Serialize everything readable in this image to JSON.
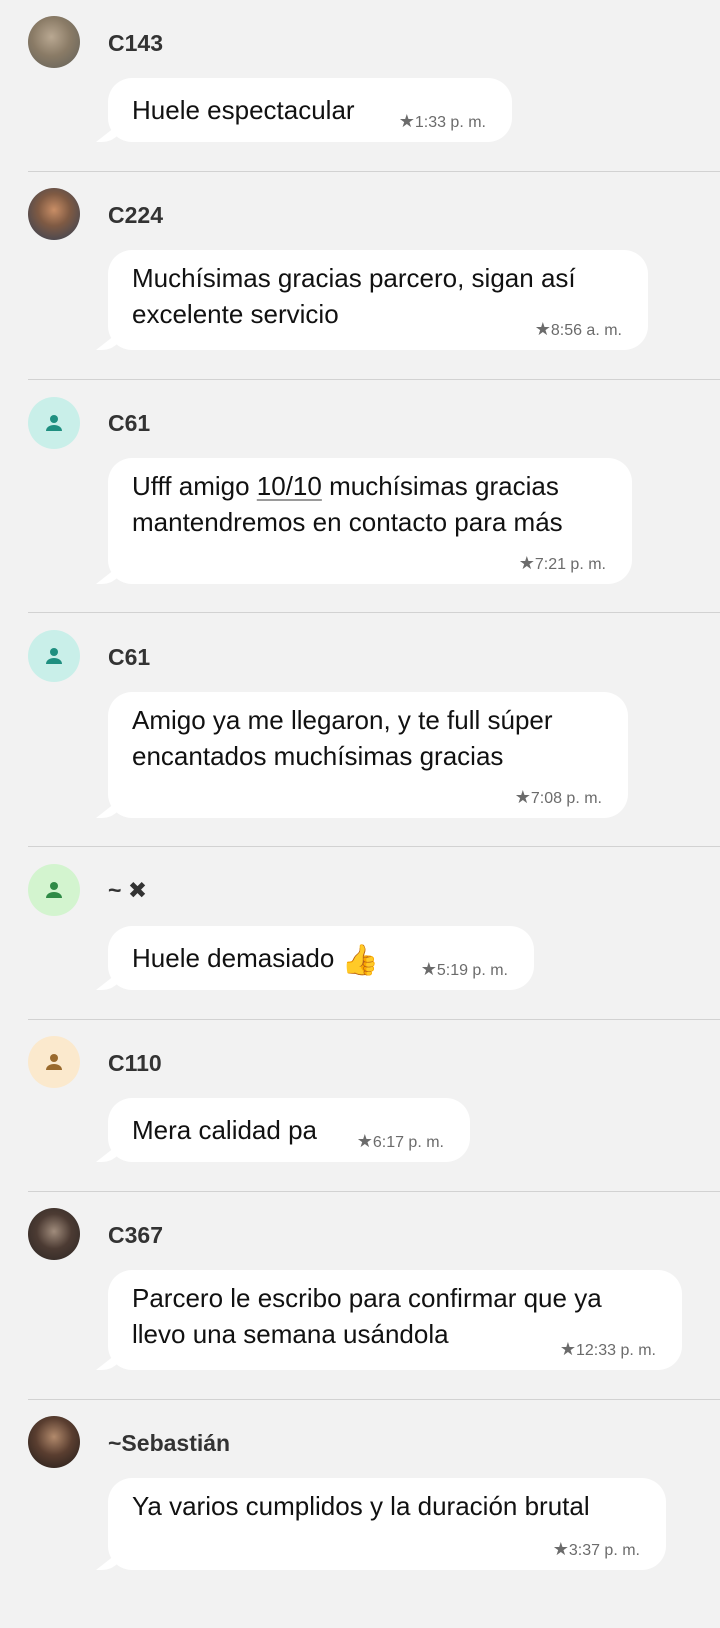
{
  "messages": [
    {
      "name": "C143",
      "text": "Huele espectacular",
      "time": "1:33 p. m.",
      "avatar": "photo"
    },
    {
      "name": "C224",
      "text": "Muchísimas gracias parcero, sigan así excelente servicio",
      "time": "8:56 a. m.",
      "avatar": "photo"
    },
    {
      "name": "C61",
      "text_before": "Ufff amigo ",
      "text_link": "10/10",
      "text_after": " muchísimas gracias mantendremos en contacto para más",
      "time": "7:21 p. m.",
      "avatar": "person-icon",
      "avatar_color": "#c9efe9"
    },
    {
      "name": "C61",
      "text": "Amigo ya me llegaron, y te full súper encantados muchísimas gracias",
      "time": "7:08 p. m.",
      "avatar": "person-icon",
      "avatar_color": "#c9efe9"
    },
    {
      "name": "~ ✖",
      "text": "Huele demasiado",
      "emoji": "👍",
      "time": "5:19 p. m.",
      "avatar": "person-icon",
      "avatar_color": "#d3f4cf"
    },
    {
      "name": "C110",
      "text": "Mera calidad pa",
      "time": "6:17 p. m.",
      "avatar": "person-icon",
      "avatar_color": "#fbe9cd"
    },
    {
      "name": "C367",
      "text": "Parcero le escribo para confirmar que ya llevo una semana usándola",
      "time": "12:33 p. m.",
      "avatar": "photo"
    },
    {
      "name": "~Sebastián",
      "text": "Ya varios cumplidos y la duración brutal",
      "time": "3:37 p. m.",
      "avatar": "photo"
    }
  ],
  "icons": {
    "star": "star-icon",
    "person": "person-icon"
  }
}
